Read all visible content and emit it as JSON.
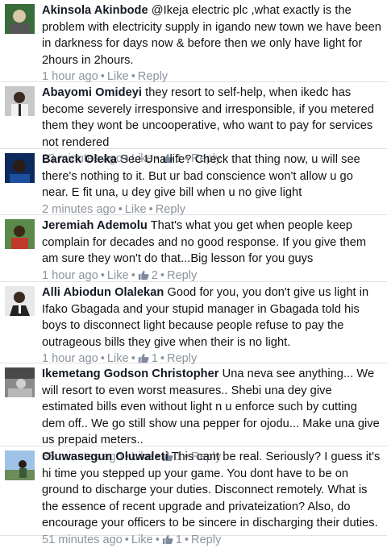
{
  "comments": [
    {
      "author": "Akinsola Akinbode",
      "text": "@Ikeja electric plc ,what exactly is the problem with electricity supply in igando new town we have been in darkness for days now & before then we only have light for 2hours in 2hours.",
      "time": "1 hour ago",
      "like_label": "Like",
      "reply_label": "Reply",
      "likes": "",
      "avatar_colors": [
        "#3a6b3a",
        "#d9c9a8"
      ]
    },
    {
      "author": "Abayomi Omideyi",
      "text": "they resort to self-help, when ikedc has become severely irresponsive and irresponsible, if you metered them they wont be uncooperative, who want to pay for services not rendered",
      "time": "23 minutes ago",
      "like_label": "Like",
      "reply_label": "Reply",
      "likes": "1",
      "avatar_colors": [
        "#c8c8c8",
        "#2a2a2a"
      ]
    },
    {
      "author": "Barack Oleka",
      "text": "See Una life?  Check that thing now, u will see there's nothing to it. But ur bad conscience won't allow u go near. E fit una, u dey give bill when u no give light",
      "time": "2 minutes ago",
      "like_label": "Like",
      "reply_label": "Reply",
      "likes": "",
      "avatar_colors": [
        "#0d2a5c",
        "#1e4fa0"
      ]
    },
    {
      "author": "Jeremiah Ademolu",
      "text": "That's what you get when people keep complain for decades and no good response. If you give them am sure they won't do that...Big lesson for you guys",
      "time": "1 hour ago",
      "like_label": "Like",
      "reply_label": "Reply",
      "likes": "2",
      "avatar_colors": [
        "#5a8a4a",
        "#c0392b"
      ]
    },
    {
      "author": "Alli Abiodun Olalekan",
      "text": "Good for you, you don't give us light in Ifako Gbagada and your stupid manager in Gbagada told his boys to disconnect light because people refuse to pay the outrageous bills they give when their is no light.",
      "time": "1 hour ago",
      "like_label": "Like",
      "reply_label": "Reply",
      "likes": "1",
      "avatar_colors": [
        "#e8e8e8",
        "#222222"
      ]
    },
    {
      "author": "Ikemetang Godson Christopher",
      "text": "Una neva see anything... We will resort to even worst measures.. Shebi una dey give estimated bills even without light n u enforce such by cutting dem  off.. We go still show una pepper for ojodu... Make una give us prepaid meters..",
      "time": "35 minutes ago",
      "like_label": "Like",
      "reply_label": "Reply",
      "likes": "1",
      "avatar_colors": [
        "#8a8a8a",
        "#d0d0d0"
      ]
    },
    {
      "author": "Oluwasegun Oluwaleti",
      "text": "This cant be real. Seriously? I guess it's hi time you stepped up your game. You dont have to be on ground to discharge your duties. Disconnect remotely. What is the essence of recent upgrade and privateization? Also, do encourage your officers to be sincere in discharging their duties.",
      "time": "51 minutes ago",
      "like_label": "Like",
      "reply_label": "Reply",
      "likes": "1",
      "avatar_colors": [
        "#9ec3e6",
        "#3a5a3a"
      ]
    }
  ],
  "colors": {
    "meta": "#8d949e",
    "text": "#111111",
    "divider": "#e1e2e3",
    "like_icon": "#7f8a9c"
  }
}
